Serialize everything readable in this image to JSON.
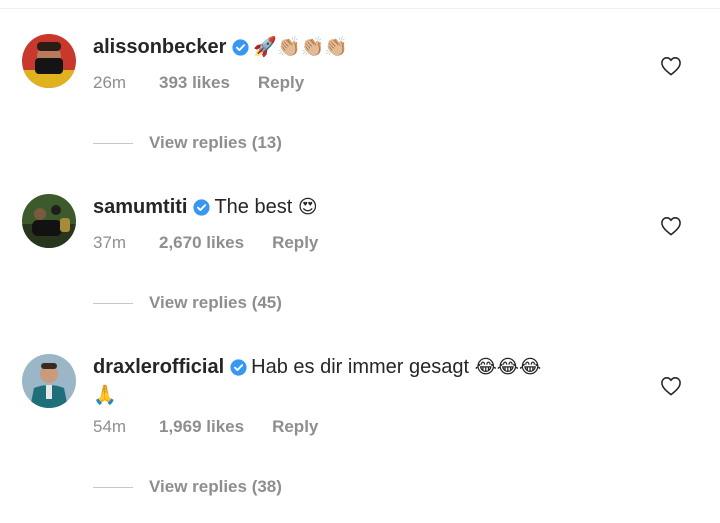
{
  "comments": [
    {
      "username": "alissonbecker",
      "text": "",
      "emoji": "🚀👏🏼👏🏼👏🏼",
      "time": "26m",
      "likes": "393 likes",
      "reply": "Reply",
      "view_replies": "View replies (13)"
    },
    {
      "username": "samumtiti",
      "text": "The best",
      "emoji": "😍",
      "time": "37m",
      "likes": "2,670 likes",
      "reply": "Reply",
      "view_replies": "View replies (45)"
    },
    {
      "username": "draxlerofficial",
      "text": "Hab es dir immer gesagt",
      "emoji": "😂😂😂",
      "emoji_line2": "🙏",
      "time": "54m",
      "likes": "1,969 likes",
      "reply": "Reply",
      "view_replies": "View replies (38)"
    }
  ],
  "icons": {
    "verified": "verified-badge-icon",
    "like": "heart-outline-icon"
  },
  "colors": {
    "verified_blue": "#3897f0",
    "meta_gray": "#8e8e8e",
    "text_dark": "#262626"
  }
}
